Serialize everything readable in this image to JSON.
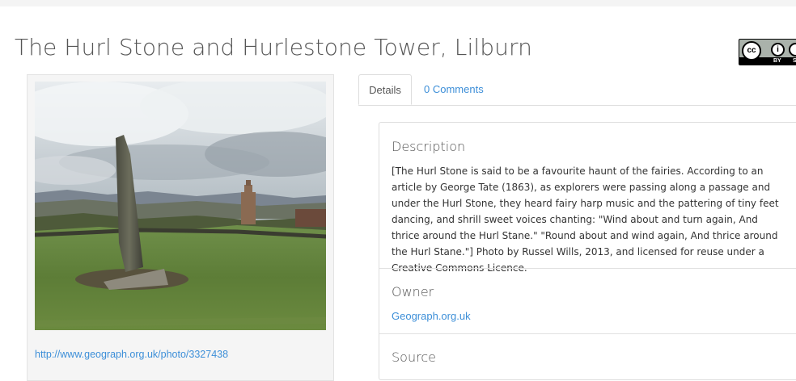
{
  "page": {
    "title": "The Hurl Stone and Hurlestone Tower, Lilburn"
  },
  "license_badge": {
    "cc": "cc",
    "by": "BY",
    "sa": "SA"
  },
  "image": {
    "link": "http://www.geograph.org.uk/photo/3327438"
  },
  "tabs": [
    {
      "label": "Details"
    },
    {
      "label": "0 Comments"
    }
  ],
  "details": {
    "description_title": "Description",
    "description_text": "[The Hurl Stone is said to be a favourite haunt of the fairies. According to an article by George Tate (1863), as explorers were passing along a passage and under the Hurl Stone, they heard fairy harp music and the pattering of tiny feet dancing, and shrill sweet voices chanting: \"Wind about and turn again, And thrice around the Hurl Stane.\" \"Round about and wind again, And thrice around the Hurl Stane.\"] Photo by Russel Wills, 2013, and licensed for reuse under a Creative Commons Licence.",
    "owner_title": "Owner",
    "owner_link": "Geograph.org.uk",
    "source_title": "Source"
  },
  "colors": {
    "link": "#3d8fd8",
    "text": "#333333",
    "title": "#555555"
  },
  "icons": [
    "creative-commons-icon"
  ]
}
